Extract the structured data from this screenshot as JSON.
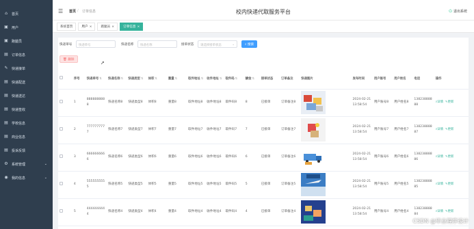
{
  "app": {
    "title": "校内快递代取服务平台",
    "logout": "退出系统"
  },
  "breadcrumb": {
    "home": "首页",
    "sep": "/",
    "current": "订单信息"
  },
  "sidebar": {
    "items": [
      {
        "label": "首页",
        "icon": "home-icon"
      },
      {
        "label": "用户",
        "icon": "user-icon"
      },
      {
        "label": "跑腿员",
        "icon": "runner-icon"
      },
      {
        "label": "订单信息",
        "icon": "order-icon"
      },
      {
        "label": "快递接单",
        "icon": "accept-icon"
      },
      {
        "label": "快递配送",
        "icon": "delivery-icon"
      },
      {
        "label": "快递送达",
        "icon": "arrived-icon"
      },
      {
        "label": "快递签收",
        "icon": "sign-icon"
      },
      {
        "label": "学校信息",
        "icon": "school-icon"
      },
      {
        "label": "商业信息",
        "icon": "shop-icon"
      },
      {
        "label": "投诉反馈",
        "icon": "feedback-icon"
      },
      {
        "label": "系统管理",
        "icon": "system-icon",
        "expand": "⌄"
      },
      {
        "label": "我的信息",
        "icon": "profile-icon",
        "expand": "⌄"
      }
    ]
  },
  "tabs": [
    {
      "label": "系统首页",
      "active": false
    },
    {
      "label": "用户",
      "active": false
    },
    {
      "label": "跑腿员",
      "active": false
    },
    {
      "label": "订单信息",
      "active": true
    }
  ],
  "search": {
    "field1_label": "快递单号",
    "field1_placeholder": "快递单号",
    "field2_label": "快递名称",
    "field2_placeholder": "快递名称",
    "field3_label": "接单状态",
    "field3_placeholder": "请选择接单状态",
    "button": "搜索"
  },
  "actions": {
    "delete": "删除"
  },
  "table": {
    "headers": [
      "",
      "序号",
      "快递单号",
      "快递名称",
      "快递类型",
      "体积",
      "重量",
      "取件地址",
      "收件地址",
      "取件码",
      "酬金",
      "接单状态",
      "订单备注",
      "快递图片",
      "发布时间",
      "用户账号",
      "用户姓名",
      "电话",
      "操作"
    ],
    "op_detail": "详情",
    "op_edit": "更新",
    "rows": [
      {
        "idx": "1",
        "no": "8888888888",
        "name": "快递名称8",
        "type": "快递类型8",
        "vol": "体积8",
        "weight": "重量8",
        "from": "取件地址8",
        "to": "收件地址8",
        "code": "取件码8",
        "fee": "8",
        "status": "已接单",
        "remark": "订单备注8",
        "img": "img-1",
        "time": "2024-02-21 13:58:54",
        "acc": "用户账号8",
        "uname": "用户姓名8",
        "tel": "13823888888"
      },
      {
        "idx": "2",
        "no": "7777777777",
        "name": "快递名称7",
        "type": "快递类型7",
        "vol": "体积7",
        "weight": "重量7",
        "from": "取件地址7",
        "to": "收件地址7",
        "code": "取件码7",
        "fee": "7",
        "status": "已接单",
        "remark": "订单备注7",
        "img": "img-2",
        "time": "2024-02-21 13:58:54",
        "acc": "用户账号7",
        "uname": "用户姓名7",
        "tel": "13823888887"
      },
      {
        "idx": "3",
        "no": "6666666666",
        "name": "快递名称6",
        "type": "快递类型6",
        "vol": "体积6",
        "weight": "重量6",
        "from": "取件地址6",
        "to": "收件地址6",
        "code": "取件码6",
        "fee": "6",
        "status": "已接单",
        "remark": "订单备注6",
        "img": "img-3",
        "time": "2024-02-21 13:58:54",
        "acc": "用户账号6",
        "uname": "用户姓名6",
        "tel": "13823888886"
      },
      {
        "idx": "4",
        "no": "5555555555",
        "name": "快递名称5",
        "type": "快递类型5",
        "vol": "体积5",
        "weight": "重量5",
        "from": "取件地址5",
        "to": "收件地址5",
        "code": "取件码5",
        "fee": "5",
        "status": "已接单",
        "remark": "订单备注5",
        "img": "img-4",
        "time": "2024-02-21 13:58:54",
        "acc": "用户账号5",
        "uname": "用户姓名5",
        "tel": "13823888885"
      },
      {
        "idx": "5",
        "no": "4444444444",
        "name": "快递名称4",
        "type": "快递类型4",
        "vol": "体积4",
        "weight": "重量4",
        "from": "取件地址4",
        "to": "收件地址4",
        "code": "取件码4",
        "fee": "4",
        "status": "已接单",
        "remark": "订单备注4",
        "img": "img-5",
        "time": "2024-02-21 13:58:54",
        "acc": "用户账号4",
        "uname": "用户姓名4",
        "tel": "13823888884"
      }
    ]
  },
  "watermark": "CSDN @毕业程序设计",
  "colors": {
    "sidebar_bg": "#2f3e4e",
    "accent": "#36b39c",
    "primary_button": "#409eff",
    "danger": "#f56c6c"
  }
}
